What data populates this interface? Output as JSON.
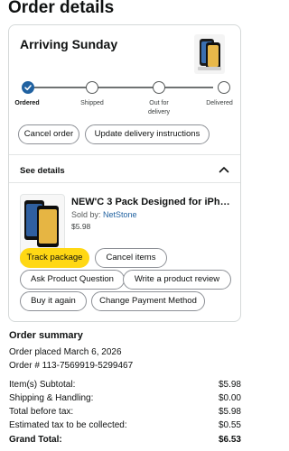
{
  "page_title": "Order details",
  "shipment": {
    "arriving": "Arriving Sunday",
    "steps": [
      {
        "label": "Ordered",
        "done": true
      },
      {
        "label": "Shipped",
        "done": false
      },
      {
        "label": "Out for\ndelivery",
        "done": false
      },
      {
        "label": "Delivered",
        "done": false
      }
    ],
    "actions": {
      "cancel_order": "Cancel order",
      "update_delivery": "Update delivery instructions"
    }
  },
  "details": {
    "label": "See details",
    "expanded_icon": "chevron-up-icon"
  },
  "item": {
    "title": "NEW'C 3 Pack Designed for iPho...",
    "sold_by_prefix": "Sold by: ",
    "seller": "NetStone",
    "price": "$5.98",
    "actions": {
      "track_package": "Track package",
      "cancel_items": "Cancel items",
      "ask_question": "Ask Product Question",
      "write_review": "Write a product review",
      "buy_again": "Buy it again",
      "change_payment": "Change Payment Method"
    }
  },
  "summary": {
    "title": "Order summary",
    "placed": "Order placed March 6, 2026",
    "order_number": "Order # 113-7569919-5299467",
    "rows": [
      {
        "label": "Item(s) Subtotal:",
        "value": "$5.98"
      },
      {
        "label": "Shipping & Handling:",
        "value": "$0.00"
      },
      {
        "label": "Total before tax:",
        "value": "$5.98"
      },
      {
        "label": "Estimated tax to be collected:",
        "value": "$0.55"
      },
      {
        "label": "Grand Total:",
        "value": "$6.53"
      }
    ]
  },
  "colors": {
    "accent_blue": "#2162a1",
    "primary_button": "#ffd814",
    "border": "#d5d9d9"
  }
}
